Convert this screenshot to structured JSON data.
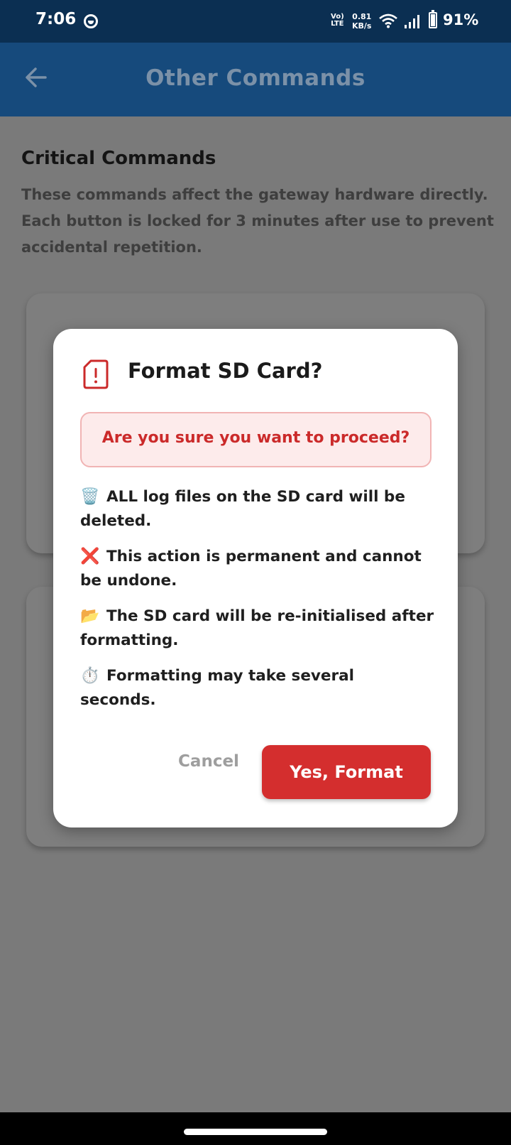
{
  "status_bar": {
    "time": "7:06",
    "network_type_top": "Vo)",
    "network_type_bottom": "LTE",
    "speed_value": "0.81",
    "speed_unit": "KB/s",
    "battery_percent": "91%"
  },
  "app_bar": {
    "title": "Other Commands"
  },
  "page": {
    "section_title": "Critical Commands",
    "section_description": "These commands affect the gateway hardware directly. Each button is locked for 3 minutes after use to prevent accidental repetition."
  },
  "dialog": {
    "title": "Format SD Card?",
    "warning": "Are you sure you want to proceed?",
    "bullets": [
      {
        "icon": "🗑️",
        "text": "ALL log files on the SD card will be deleted."
      },
      {
        "icon": "❌",
        "text": "This action is permanent and cannot be undone."
      },
      {
        "icon": "📂",
        "text": "The SD card will be re-initialised after formatting."
      },
      {
        "icon": "⏱️",
        "text": "Formatting may take several seconds."
      }
    ],
    "cancel_label": "Cancel",
    "confirm_label": "Yes, Format"
  },
  "colors": {
    "app_bar": "#164a7c",
    "status_bar": "#0b2f52",
    "confirm_button": "#d42e2e",
    "warning_text": "#cb2a2a",
    "warning_background": "#fdebeb"
  }
}
